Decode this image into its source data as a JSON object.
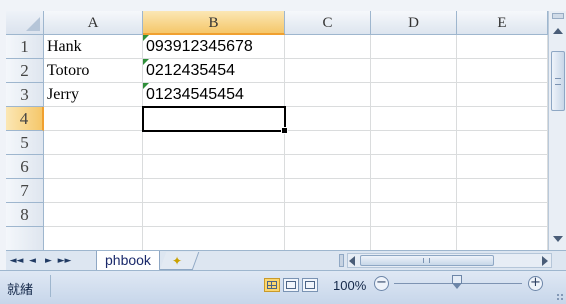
{
  "columns": [
    "A",
    "B",
    "C",
    "D",
    "E"
  ],
  "rows": [
    "1",
    "2",
    "3",
    "4",
    "5",
    "6",
    "7",
    "8"
  ],
  "cells": [
    {
      "a": "Hank",
      "b": "093912345678"
    },
    {
      "a": "Totoro",
      "b": "0212435454"
    },
    {
      "a": "Jerry",
      "b": "01234545454"
    }
  ],
  "selection": {
    "column": "B",
    "row": "4"
  },
  "sheet_tabs": [
    "phbook"
  ],
  "status": {
    "ready_text": "就緒",
    "zoom_label": "100%"
  },
  "icons": {
    "first_sheet": "◄◄",
    "prev_sheet": "◄",
    "next_sheet": "►",
    "last_sheet": "►►",
    "zoom_minus": "−",
    "zoom_plus": "+"
  },
  "colors": {
    "selection_header": "#f5c76a",
    "text_indicator": "#2f8f3a",
    "status_bar": "#c7d6ea"
  }
}
